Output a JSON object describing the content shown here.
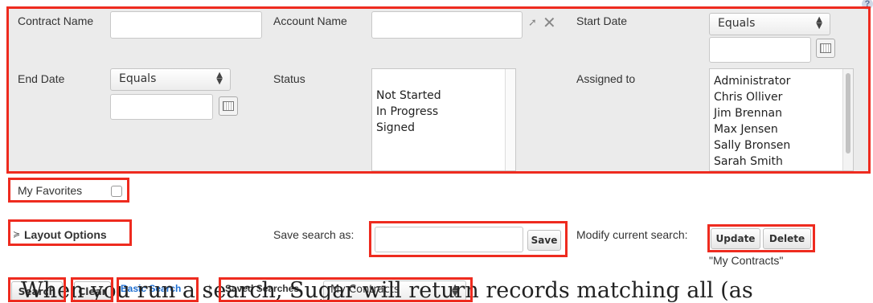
{
  "fields": {
    "contract_name_label": "Contract Name",
    "account_name_label": "Account Name",
    "start_date_label": "Start Date",
    "start_date_operator": "Equals",
    "end_date_label": "End Date",
    "end_date_operator": "Equals",
    "status_label": "Status",
    "status_options": [
      "Not Started",
      "In Progress",
      "Signed"
    ],
    "assigned_to_label": "Assigned to",
    "assigned_to_options": [
      "Administrator",
      "Chris Olliver",
      "Jim Brennan",
      "Max Jensen",
      "Sally Bronsen",
      "Sarah Smith"
    ]
  },
  "favorites": {
    "label": "My Favorites"
  },
  "layout_options": {
    "label": "Layout Options",
    "icon": "double-chevron-down-icon"
  },
  "save_search": {
    "label": "Save search as:",
    "button": "Save"
  },
  "modify_search": {
    "label": "Modify current search:",
    "update": "Update",
    "delete": "Delete",
    "current_name": "\"My Contracts\""
  },
  "bottom_bar": {
    "search": "Search",
    "clear": "Clear",
    "basic_search": "Basic Search",
    "separator": "|",
    "saved_searches_label": "Saved Searches",
    "saved_searches_value": "My Contracts"
  },
  "caption": "When you run a search, Sugar will return records matching all (as",
  "colors": {
    "highlight": "#ee2b1f",
    "panel": "#ebebeb",
    "link": "#1f6fd1"
  }
}
